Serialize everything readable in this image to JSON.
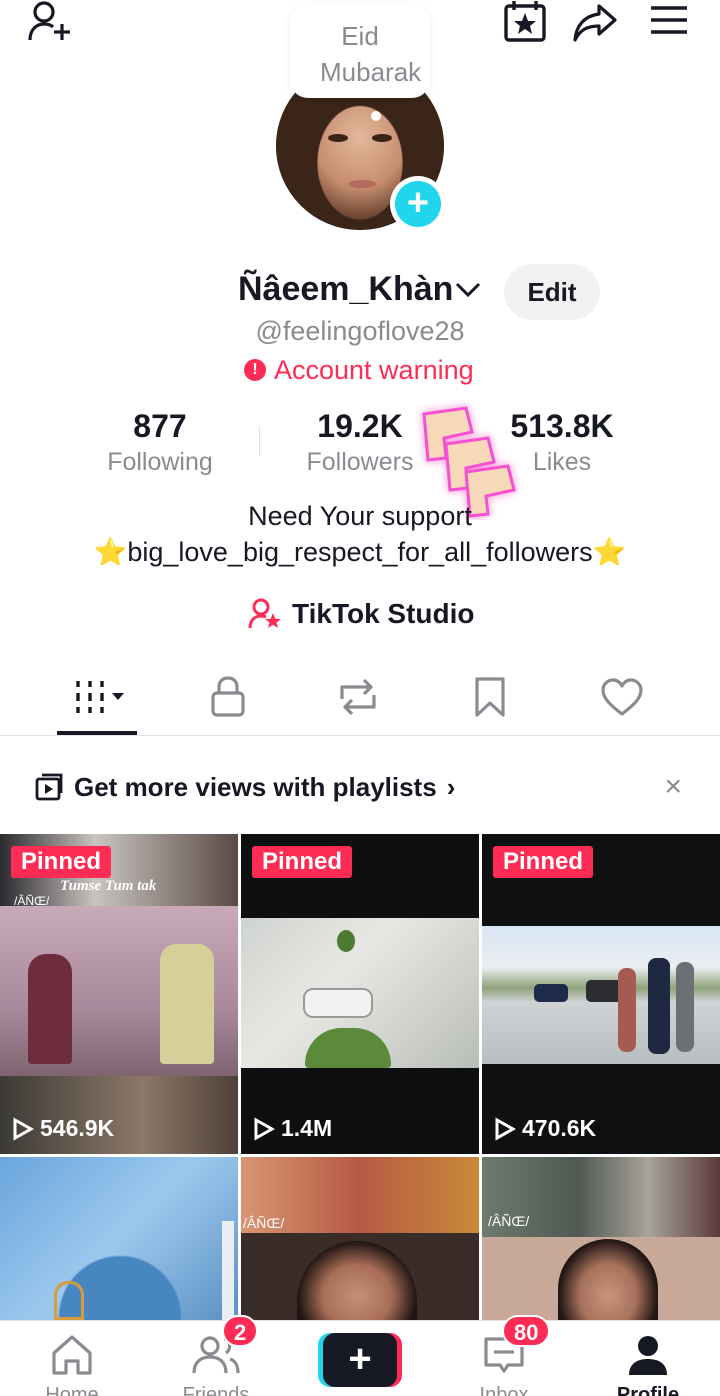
{
  "profile": {
    "status_note": "Eid Mubarak",
    "display_name": "Ñâeem_Khàn",
    "edit_label": "Edit",
    "handle": "@feelingoflove28",
    "warning": "Account warning",
    "stats": [
      {
        "value": "877",
        "label": "Following"
      },
      {
        "value": "19.2K",
        "label": "Followers"
      },
      {
        "value": "513.8K",
        "label": "Likes"
      }
    ],
    "bio_line1": "Need Your support",
    "bio_line2": "⭐big_love_big_respect_for_all_followers⭐",
    "studio_label": "TikTok Studio"
  },
  "tabs": [
    "videos-grid",
    "private",
    "reposts",
    "favorites",
    "liked"
  ],
  "playlist_banner": {
    "text": "Get more views with playlists",
    "arrow": "›",
    "close": "×"
  },
  "videos": [
    {
      "pinned": "Pinned",
      "views": "546.9K",
      "caption": "Tumse Tum tak",
      "watermark": "/ÂÑŒ/"
    },
    {
      "pinned": "Pinned",
      "views": "1.4M"
    },
    {
      "pinned": "Pinned",
      "views": "470.6K"
    },
    {
      "views": ""
    },
    {
      "watermark": "/ÂÑŒ/"
    },
    {
      "watermark": "/ÂÑŒ/"
    }
  ],
  "bottom_nav": {
    "home": "Home",
    "friends": "Friends",
    "friends_badge": "2",
    "inbox": "Inbox",
    "inbox_badge": "80",
    "profile": "Profile",
    "create": "+"
  },
  "colors": {
    "accent": "#fe2c55",
    "cyan": "#20d5ec",
    "text": "#161823",
    "muted": "#8a8b91"
  }
}
